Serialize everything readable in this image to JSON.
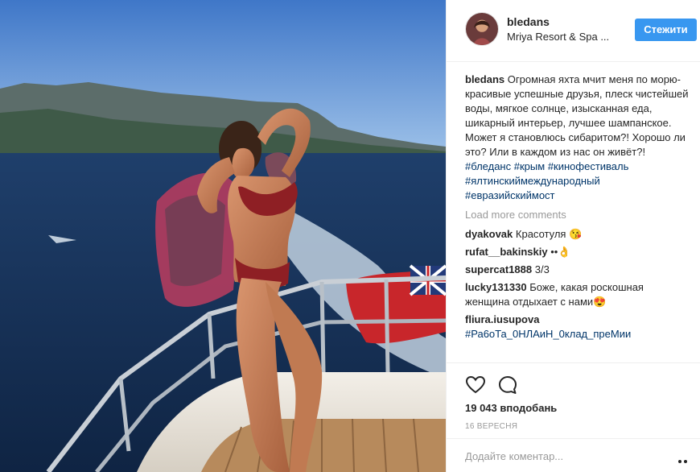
{
  "post": {
    "username": "bledans",
    "location": "Mriya Resort & Spa ...",
    "follow_label": "Стежити"
  },
  "caption": {
    "username": "bledans",
    "text": "Огромная яхта мчит меня по морю- красивые успешные друзья, плеск чистейшей воды, мягкое солнце, изысканная еда, шикарный интерьер, лучшее шампанское. Может я становлюсь сибаритом?! Хорошо ли это? Или в каждом из нас он живёт?!",
    "hashtags": [
      "#бледанс",
      "#крым",
      "#кинофестиваль",
      "#ялтинскиймеждународный",
      "#евразийскиймост"
    ]
  },
  "load_more_label": "Load more comments",
  "comments": [
    {
      "username": "dyakovak",
      "text": "Красотуля 😘"
    },
    {
      "username": "rufat__bakinskiy",
      "text": "••👌"
    },
    {
      "username": "supercat1888",
      "text": "3/3"
    },
    {
      "username": "lucky131330",
      "text": "Боже, какая роскошная женщина отдыхает с нами😍"
    },
    {
      "username": "fliura.iusupova",
      "text": "#Ра6оТа_0НЛАиН_0клад_пpeMии"
    }
  ],
  "likes_text": "19 043 вподобань",
  "date_text": "16 ВЕРЕСНЯ",
  "add_comment_placeholder": "Додайте коментар...",
  "icons": {
    "like": "heart-icon",
    "comment": "comment-bubble-icon",
    "more": "more-options-icon"
  },
  "colors": {
    "accent": "#3897f0",
    "hashtag": "#003569",
    "muted": "#999999",
    "text": "#262626"
  }
}
